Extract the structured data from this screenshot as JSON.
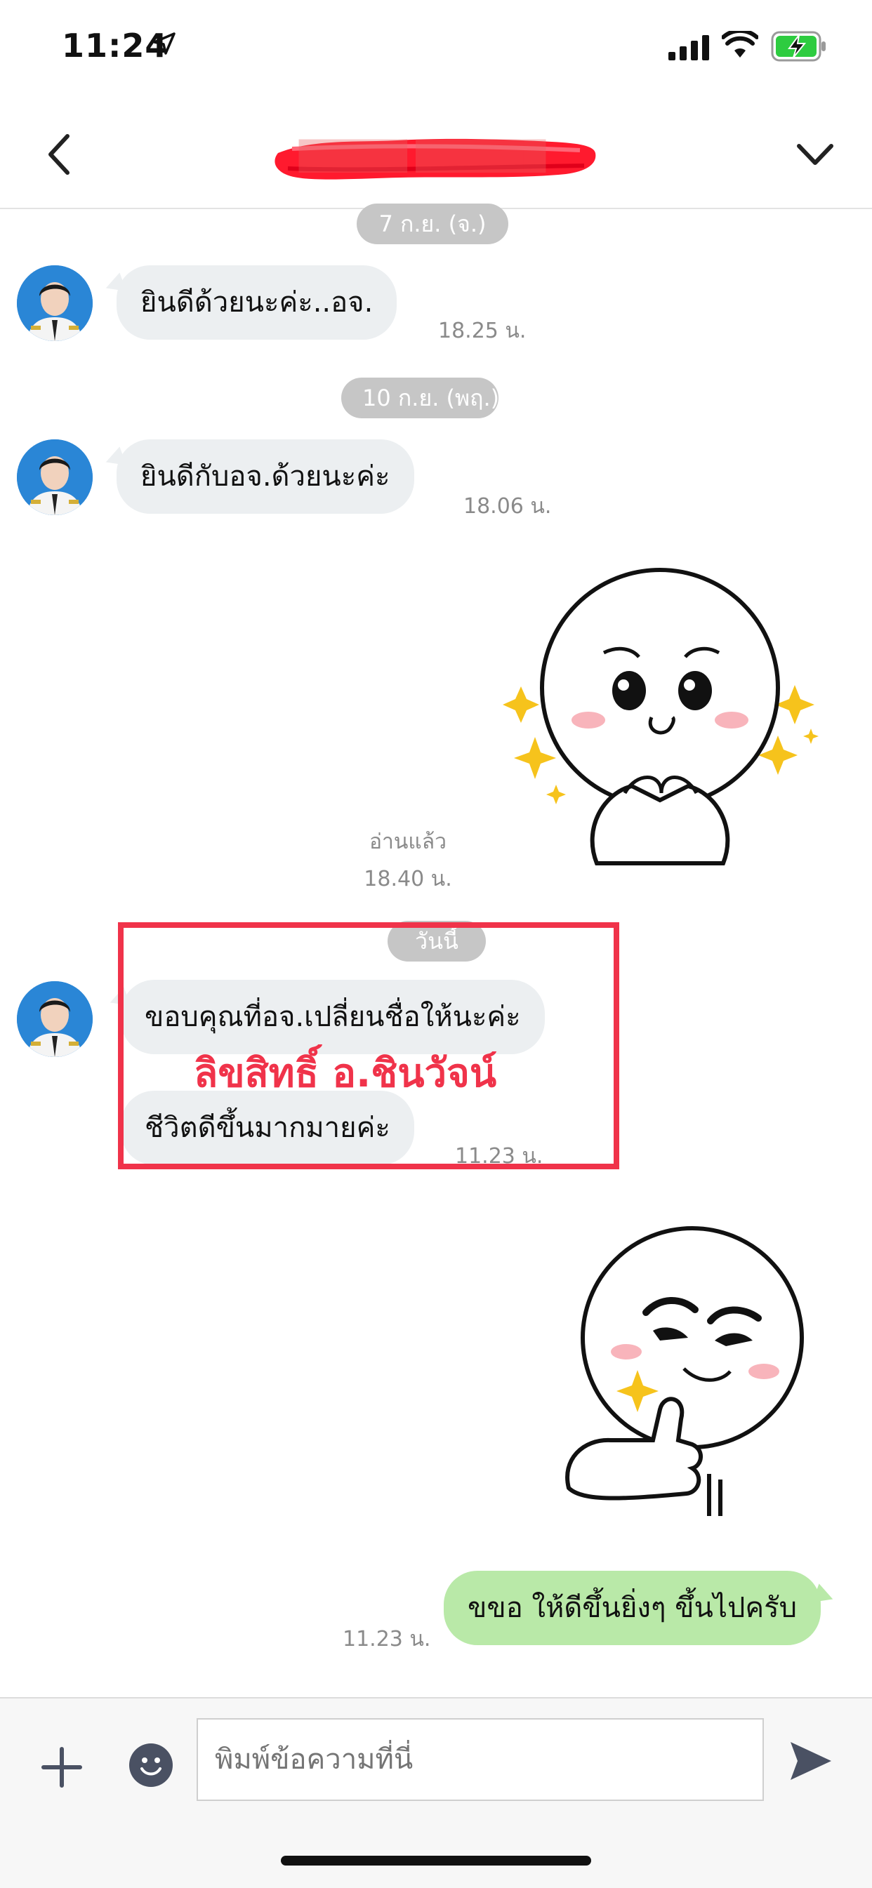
{
  "status_bar": {
    "time": "11:24",
    "icons": [
      "location-arrow-icon",
      "signal-icon",
      "wifi-icon",
      "battery-charging-icon"
    ]
  },
  "header": {
    "title": "█████ ██████",
    "back_icon": "chevron-left-icon",
    "menu_icon": "chevron-down-icon"
  },
  "messages": {
    "date1": "7 ก.ย. (จ.)",
    "msg1": {
      "text": "ยินดีด้วยนะค่ะ..อจ.",
      "time": "18.25 น."
    },
    "date2": "10 ก.ย. (พฤ.)",
    "msg2": {
      "text": "ยินดีกับอจ.ด้วยนะค่ะ",
      "time": "18.06 น."
    },
    "sticker1": {
      "read": "อ่านแล้ว",
      "time": "18.40 น."
    },
    "date3": "วันนี้",
    "msg3": {
      "line1": "ขอบคุณที่อจ.เปลี่ยนชื่อให้นะค่ะ",
      "line2": "ชีวิตดีขึ้นมากมายค่ะ",
      "time": "11.23 น."
    },
    "overlay": "ลิขสิทธิ์  อ.ชินวัจน์",
    "sent_msg": {
      "text": "ขขอ ให้ดีขึ้นยิ่งๆ ขึ้นไปครับ",
      "time": "11.23 น."
    }
  },
  "input_bar": {
    "placeholder": "พิมพ์ข้อความที่นี่",
    "icons": [
      "plus-icon",
      "emoji-icon",
      "send-icon"
    ]
  },
  "colors": {
    "highlight": "#f0334a",
    "sent_bubble": "#b9e9a8",
    "received_bubble": "#eceff1",
    "date_pill": "#c6c6c6"
  }
}
